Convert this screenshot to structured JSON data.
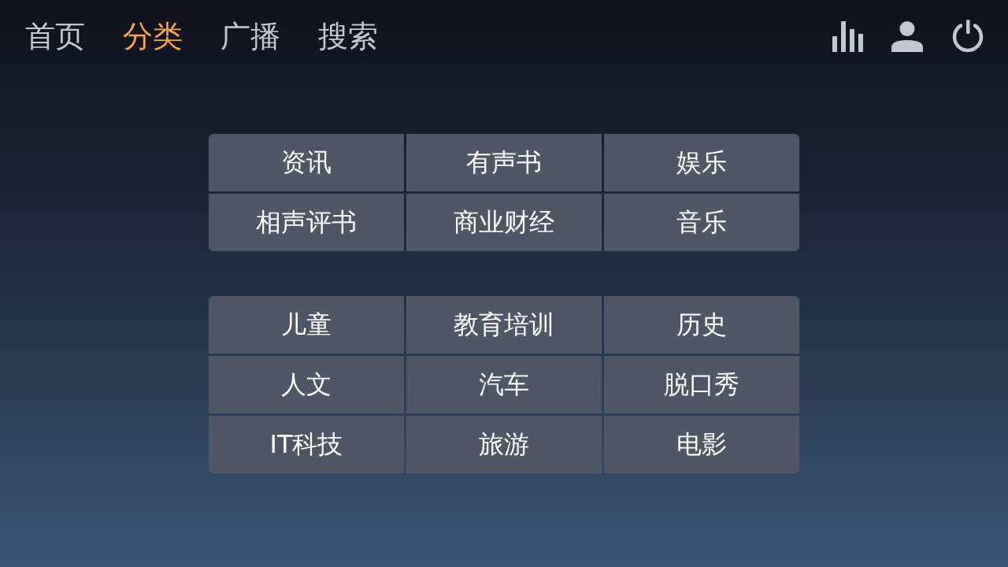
{
  "tabs": [
    {
      "label": "首页",
      "selected": false
    },
    {
      "label": "分类",
      "selected": true
    },
    {
      "label": "广播",
      "selected": false
    },
    {
      "label": "搜索",
      "selected": false
    }
  ],
  "category_groups": [
    [
      "资讯",
      "有声书",
      "娱乐",
      "相声评书",
      "商业财经",
      "音乐"
    ],
    [
      "儿童",
      "教育培训",
      "历史",
      "人文",
      "汽车",
      "脱口秀",
      "IT科技",
      "旅游",
      "电影"
    ]
  ]
}
